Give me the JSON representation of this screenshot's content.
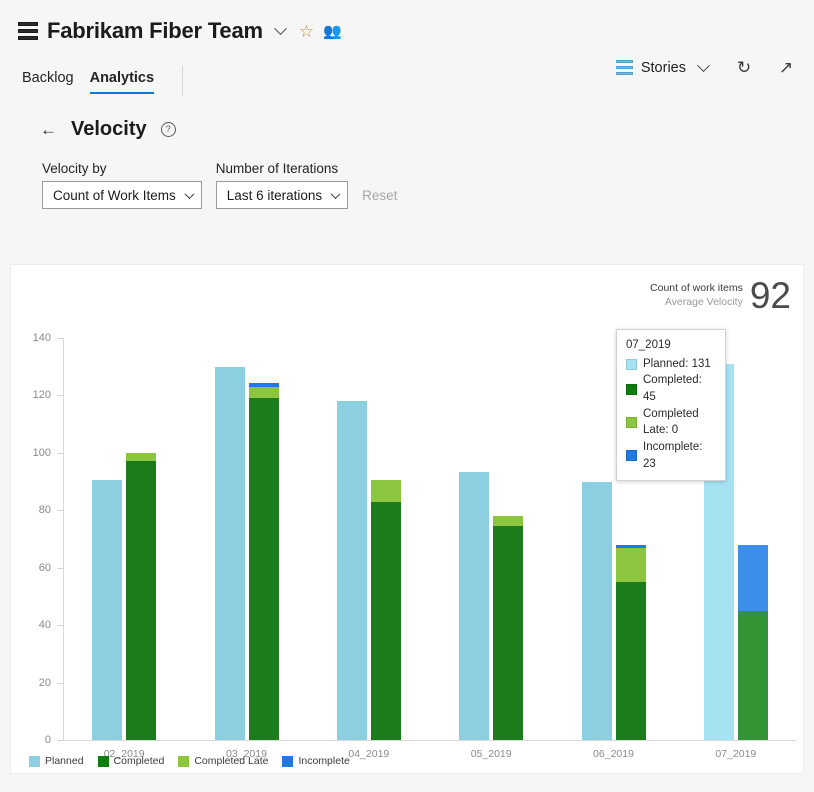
{
  "header": {
    "team_name": "Fabrikam Fiber Team",
    "team_icon": "team-list-icon",
    "chevron_icon": "chevron-down-icon",
    "favorite_icon": "star-icon",
    "people_icon": "people-icon",
    "tabs": [
      {
        "label": "Backlog",
        "active": false
      },
      {
        "label": "Analytics",
        "active": true
      }
    ],
    "stories_label": "Stories",
    "stories_icon": "backlog-list-icon",
    "stories_chevron": "chevron-down-icon",
    "refresh_icon": "refresh-icon",
    "fullscreen_icon": "expand-icon"
  },
  "subheader": {
    "back_icon": "back-arrow-icon",
    "page_title": "Velocity",
    "help_icon": "question-circle-icon"
  },
  "controls": {
    "velocity_by": {
      "label": "Velocity by",
      "value": "Count of Work Items",
      "chevron_icon": "chevron-down-icon"
    },
    "iterations": {
      "label": "Number of Iterations",
      "value": "Last 6 iterations",
      "chevron_icon": "chevron-down-icon"
    },
    "reset_label": "Reset"
  },
  "summary": {
    "line1": "Count of work items",
    "line2": "Average Velocity",
    "value": "92"
  },
  "tooltip": {
    "title": "07_2019",
    "rows": [
      {
        "label": "Planned: 131",
        "color": "#a5e3f2"
      },
      {
        "label": "Completed: 45",
        "color": "#107c10"
      },
      {
        "label": "Completed Late: 0",
        "color": "#8cc63e"
      },
      {
        "label": "Incomplete: 23",
        "color": "#1f7ae0"
      }
    ]
  },
  "colors": {
    "planned": "#8bcfe1",
    "planned_highlight": "#a5e3f2",
    "completed": "#1b7c1b",
    "completed_highlight": "#339436",
    "completed_late": "#8cc63e",
    "completed_late_highlight": "#9ed152",
    "incomplete": "#1f7ae0",
    "incomplete_highlight": "#3b8fe8",
    "accent": "#0078d4"
  },
  "chart_data": {
    "type": "bar",
    "title": "Velocity",
    "xlabel": "",
    "ylabel": "Count of work items",
    "ylim": [
      0,
      140
    ],
    "yticks": [
      0,
      20,
      40,
      60,
      80,
      100,
      120,
      140
    ],
    "grid": false,
    "legend_position": "bottom-left",
    "categories": [
      "02_2019",
      "03_2019",
      "04_2019",
      "05_2019",
      "06_2019",
      "07_2019"
    ],
    "series": [
      {
        "name": "Planned",
        "values": [
          90.5,
          130,
          118,
          93.5,
          90,
          131
        ]
      },
      {
        "name": "Completed",
        "values": [
          97,
          119,
          83,
          74.5,
          55,
          45
        ]
      },
      {
        "name": "Completed Late",
        "values": [
          3,
          4,
          7.5,
          3.5,
          12,
          0
        ]
      },
      {
        "name": "Incomplete",
        "values": [
          0,
          1.5,
          0,
          0,
          1,
          23
        ]
      }
    ],
    "highlighted_category": "07_2019",
    "legend": [
      {
        "label": "Planned",
        "color": "#8bcfe1"
      },
      {
        "label": "Completed",
        "color": "#107c10"
      },
      {
        "label": "Completed Late",
        "color": "#8cc63e"
      },
      {
        "label": "Incomplete",
        "color": "#1f7ae0"
      }
    ]
  }
}
